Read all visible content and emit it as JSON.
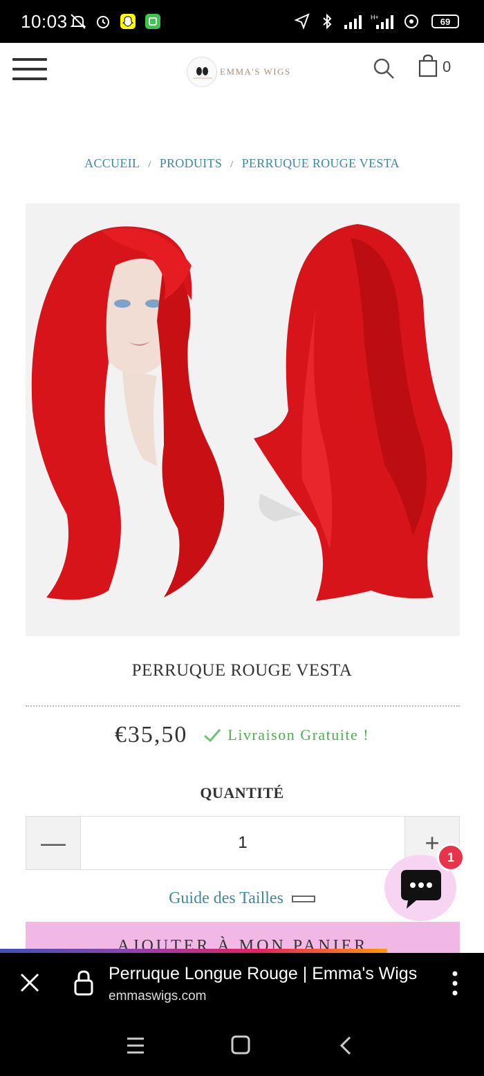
{
  "status_bar": {
    "time": "10:03",
    "battery": "69"
  },
  "header": {
    "logo_text": "EMMA'S WIGS",
    "cart_count": "0"
  },
  "breadcrumb": {
    "home": "ACCUEIL",
    "products": "PRODUITS",
    "current": "PERRUQUE ROUGE VESTA",
    "separator": "/"
  },
  "product": {
    "title": "PERRUQUE ROUGE VESTA",
    "price": "€35,50",
    "shipping": "Livraison Gratuite !",
    "quantity_label": "QUANTITÉ",
    "quantity": "1",
    "minus": "—",
    "plus": "+",
    "size_guide": "Guide des Tailles",
    "add_to_cart": "AJOUTER À MON PANIER",
    "hair_color": "#d7141a"
  },
  "chat": {
    "badge": "1"
  },
  "browser": {
    "page_title": "Perruque Longue Rouge | Emma's Wigs",
    "domain": "emmaswigs.com"
  },
  "colors": {
    "accent_link": "#3b8aa0",
    "shipping_green": "#4caf50",
    "cart_button": "#f1b8e6",
    "badge_red": "#e8344a"
  }
}
